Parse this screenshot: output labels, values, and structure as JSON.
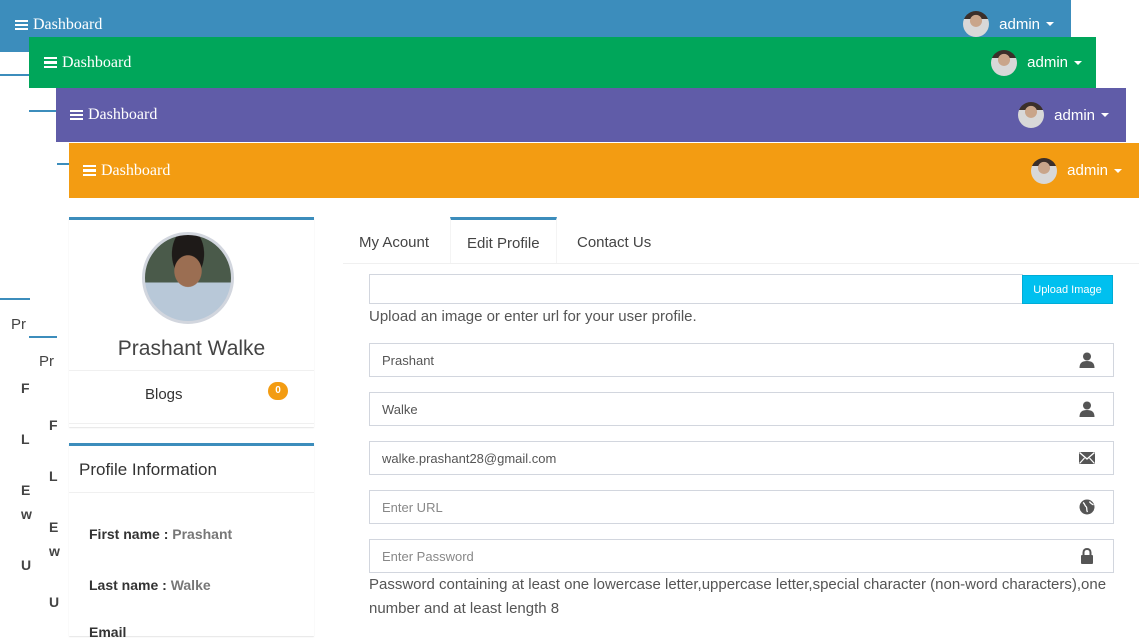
{
  "navbars": [
    {
      "brand": "Dashboard",
      "user": "admin",
      "color": "#3c8dbc"
    },
    {
      "brand": "Dashboard",
      "user": "admin",
      "color": "#00a65a"
    },
    {
      "brand": "Dashboard",
      "user": "admin",
      "color": "#605ca8"
    },
    {
      "brand": "Dashboard",
      "user": "admin",
      "color": "#f39c12"
    }
  ],
  "background_layers": {
    "profile_text_1": "Pr",
    "profile_text_2": "Pr",
    "letters": [
      "F",
      "L",
      "E",
      "w",
      "U",
      "F",
      "L",
      "E",
      "w",
      "U"
    ]
  },
  "profile": {
    "name": "Prashant Walke",
    "blogs_label": "Blogs",
    "blogs_count": "0"
  },
  "profile_info": {
    "title": "Profile Information",
    "first_name_label": "First name :",
    "first_name": "Prashant",
    "last_name_label": "Last name :",
    "last_name": "Walke",
    "email_label": "Email"
  },
  "tabs": [
    {
      "label": "My Acount",
      "active": false
    },
    {
      "label": "Edit Profile",
      "active": true
    },
    {
      "label": "Contact Us",
      "active": false
    }
  ],
  "form": {
    "image_url_value": "",
    "upload_button": "Upload Image",
    "upload_help": "Upload an image or enter url for your user profile.",
    "first_name": "Prashant",
    "last_name": "Walke",
    "email": "walke.prashant28@gmail.com",
    "url_placeholder": "Enter URL",
    "password_placeholder": "Enter Password",
    "password_help": "Password containing at least one lowercase letter,uppercase letter,special character (non-word characters),one number and at least length 8"
  },
  "colors": {
    "accent": "#3c8dbc",
    "badge": "#f39c12",
    "upload_button": "#00c0ef"
  }
}
